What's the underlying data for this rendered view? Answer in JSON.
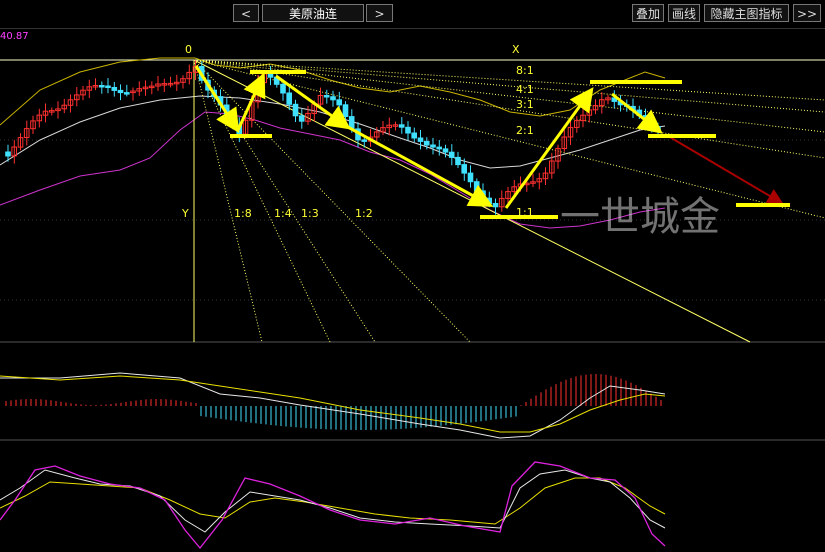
{
  "toolbar": {
    "prev_label": "<",
    "symbol": "美原油连",
    "next_label": ">",
    "overlay_label": "叠加",
    "draw_label": "画线",
    "hide_main_label": "隐藏主图指标",
    "more_label": ">>"
  },
  "price_readout": "40.87",
  "watermark": "一世城金",
  "gann_fan": {
    "origin_label": "0",
    "x_label": "X",
    "y_label": "Y",
    "upper_ratios": [
      "8:1",
      "4:1",
      "3:1",
      "2:1",
      "1:1"
    ],
    "lower_ratios": [
      "1:8",
      "1:4",
      "1:3",
      "1:2"
    ]
  },
  "colors": {
    "background": "#000000",
    "up_candle": "#ff3030",
    "down_candle": "#40e0ff",
    "fan_line": "#ffff66",
    "swing_arrow": "#ffff00",
    "bb_upper": "#c8b400",
    "bb_middle": "#d8d8d8",
    "bb_lower": "#cc33cc",
    "projection_arrow": "#aa0000"
  },
  "chart_data": [
    {
      "type": "candlestick",
      "panel": "main",
      "overlays": [
        "bollinger_upper",
        "bollinger_middle",
        "bollinger_lower",
        "gann_fan",
        "swing_arrows"
      ],
      "candle_count": 105,
      "grid": false
    },
    {
      "type": "macd",
      "panel": "indicator_1",
      "series": [
        {
          "name": "",
          "style": "line"
        },
        {
          "name": "",
          "style": "line"
        },
        {
          "name": "",
          "style": "histogram"
        }
      ]
    },
    {
      "type": "line",
      "panel": "indicator_2",
      "series": [
        {
          "name": "",
          "style": "line"
        },
        {
          "name": "",
          "style": "line"
        },
        {
          "name": "",
          "style": "line"
        }
      ]
    }
  ]
}
